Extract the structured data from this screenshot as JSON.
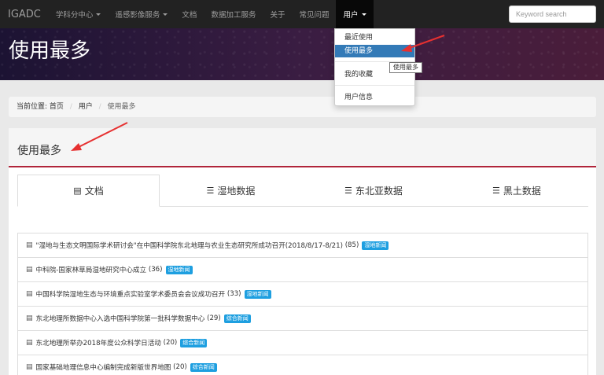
{
  "navbar": {
    "brand": "IGADC",
    "items": [
      {
        "label": "学科分中心",
        "caret": true
      },
      {
        "label": "遥感影像服务",
        "caret": true
      },
      {
        "label": "文档",
        "caret": false
      },
      {
        "label": "数据加工服务",
        "caret": false
      },
      {
        "label": "关于",
        "caret": false
      },
      {
        "label": "常见问题",
        "caret": false
      },
      {
        "label": "用户",
        "caret": true
      }
    ],
    "search_placeholder": "Keyword search"
  },
  "banner": {
    "title": "使用最多"
  },
  "dropdown": {
    "items": [
      "最近使用",
      "使用最多",
      "我的收藏",
      "用户信息"
    ],
    "active": "使用最多"
  },
  "tooltip": "使用最多",
  "breadcrumb": {
    "prefix": "当前位置:",
    "home": "首页",
    "section": "用户",
    "current": "使用最多"
  },
  "panel": {
    "title": "使用最多"
  },
  "tabs": [
    {
      "label": "文档",
      "icon": "document-icon"
    },
    {
      "label": "湿地数据",
      "icon": "database-icon"
    },
    {
      "label": "东北亚数据",
      "icon": "database-icon"
    },
    {
      "label": "黑土数据",
      "icon": "database-icon"
    }
  ],
  "list": [
    {
      "text": "\"湿地与生态文明国际学术研讨会\"在中国科学院东北地理与农业生态研究所成功召开(2018/8/17-8/21)",
      "count": "(85)",
      "badge": "湿地新闻"
    },
    {
      "text": "中科院-国家林草局湿地研究中心成立",
      "count": "(36)",
      "badge": "湿地新闻"
    },
    {
      "text": "中国科学院湿地生态与环境重点实验室学术委员会会议成功召开",
      "count": "(33)",
      "badge": "湿地新闻"
    },
    {
      "text": "东北地理所数据中心入选中国科学院第一批科学数据中心",
      "count": "(29)",
      "badge": "综合新闻"
    },
    {
      "text": "东北地理所举办2018年度公众科学日活动",
      "count": "(20)",
      "badge": "综合新闻"
    },
    {
      "text": "国家基础地理信息中心编制完成新版世界地图",
      "count": "(20)",
      "badge": "综合新闻"
    }
  ],
  "colors": {
    "accent": "#b0243a",
    "navbar": "#222222",
    "badge": "#1e9fe0",
    "dropdown_active": "#337ab7",
    "arrow": "#e63030"
  }
}
